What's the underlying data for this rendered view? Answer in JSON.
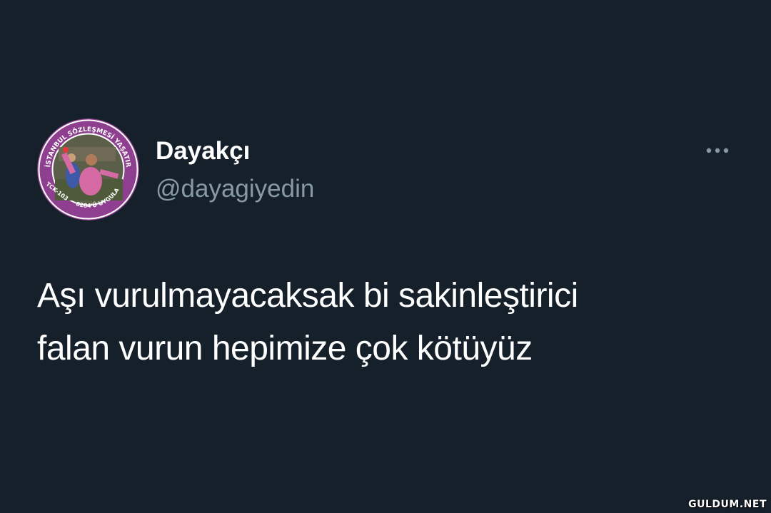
{
  "tweet": {
    "display_name": "Dayakçı",
    "handle": "@dayagiyedin",
    "text_lines": [
      "Aşı vurulmayacaksak bi sakinleştirici",
      "falan vurun hepimize çok kötüyüz"
    ]
  },
  "avatar": {
    "ring_text_top": "İSTANBUL SÖZLEŞMESİ YAŞATIR",
    "ring_text_left": "TCK-103",
    "ring_text_bottom": "6284'Ü UYGULA",
    "ring_color": "#8e3f8f"
  },
  "more_icon": "more-horizontal-icon",
  "watermark": "GULDUM.NET",
  "colors": {
    "background": "#15202b",
    "primary_text": "#ffffff",
    "secondary_text": "#8899a6"
  }
}
